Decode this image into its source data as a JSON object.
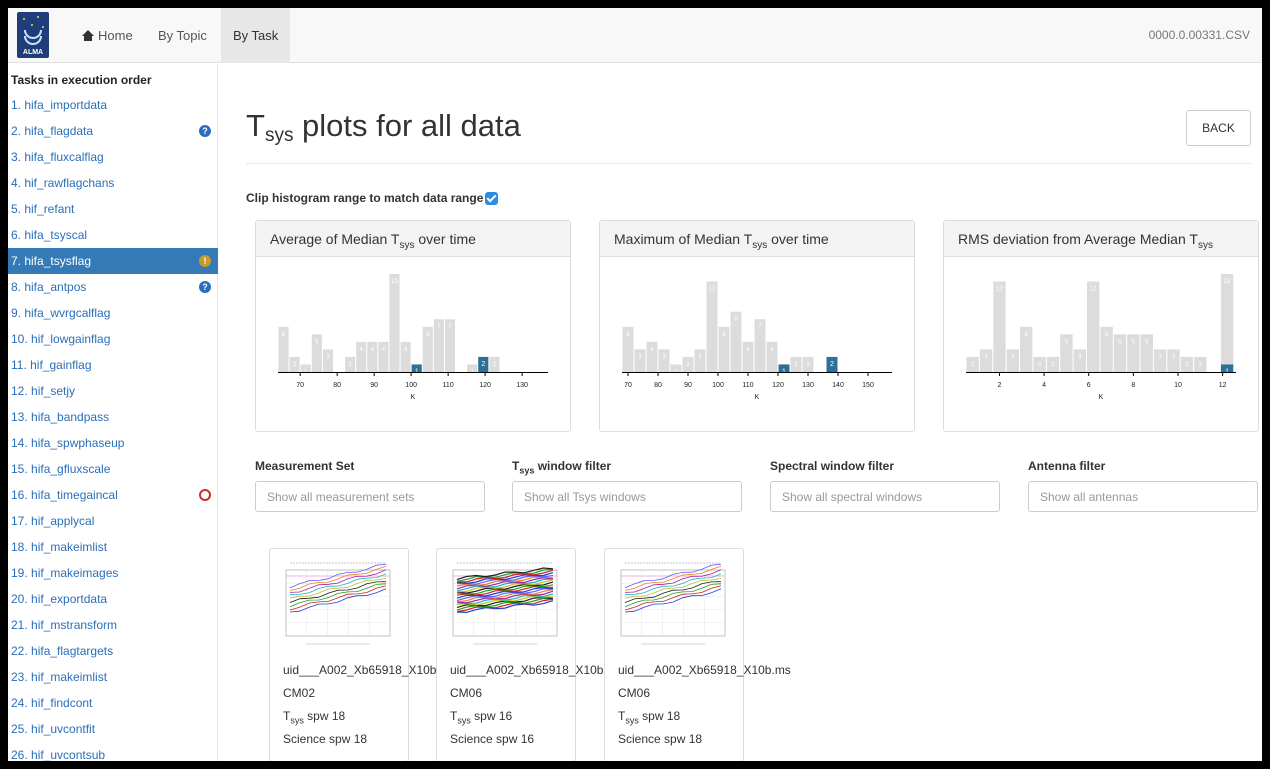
{
  "navbar": {
    "logo_text": "ALMA",
    "home_label": "Home",
    "by_topic_label": "By Topic",
    "by_task_label": "By Task",
    "filename": "0000.0.00331.CSV"
  },
  "sidebar": {
    "title": "Tasks in execution order",
    "items": [
      {
        "label": "1. hifa_importdata"
      },
      {
        "label": "2. hifa_flagdata",
        "badge": "info"
      },
      {
        "label": "3. hifa_fluxcalflag"
      },
      {
        "label": "4. hif_rawflagchans"
      },
      {
        "label": "5. hif_refant"
      },
      {
        "label": "6. hifa_tsyscal"
      },
      {
        "label": "7. hifa_tsysflag",
        "badge": "warning",
        "active": true
      },
      {
        "label": "8. hifa_antpos",
        "badge": "info"
      },
      {
        "label": "9. hifa_wvrgcalflag"
      },
      {
        "label": "10. hif_lowgainflag"
      },
      {
        "label": "11. hif_gainflag"
      },
      {
        "label": "12. hif_setjy"
      },
      {
        "label": "13. hifa_bandpass"
      },
      {
        "label": "14. hifa_spwphaseup"
      },
      {
        "label": "15. hifa_gfluxscale"
      },
      {
        "label": "16. hifa_timegaincal",
        "badge": "error"
      },
      {
        "label": "17. hif_applycal"
      },
      {
        "label": "18. hif_makeimlist"
      },
      {
        "label": "19. hif_makeimages"
      },
      {
        "label": "20. hif_exportdata"
      },
      {
        "label": "21. hif_mstransform"
      },
      {
        "label": "22. hifa_flagtargets"
      },
      {
        "label": "23. hif_makeimlist"
      },
      {
        "label": "24. hif_findcont"
      },
      {
        "label": "25. hif_uvcontfit"
      },
      {
        "label": "26. hif_uvcontsub"
      }
    ]
  },
  "main": {
    "title_prefix": "T",
    "title_sub": "sys",
    "title_rest": " plots for all data",
    "back_label": "BACK",
    "clip_label": "Clip histogram range to match data range",
    "clip_checked": true
  },
  "panels": [
    {
      "pre": "Average of Median T",
      "sub": "sys",
      "post": " over time"
    },
    {
      "pre": "Maximum of Median T",
      "sub": "sys",
      "post": " over time"
    },
    {
      "pre": "RMS deviation from Average Median T",
      "sub": "sys",
      "post": ""
    }
  ],
  "filters": [
    {
      "label_pre": "Measurement Set",
      "label_sub": "",
      "label_post": "",
      "placeholder": "Show all measurement sets"
    },
    {
      "label_pre": "T",
      "label_sub": "sys",
      "label_post": " window filter",
      "placeholder": "Show all Tsys windows"
    },
    {
      "label_pre": "Spectral window filter",
      "label_sub": "",
      "label_post": "",
      "placeholder": "Show all spectral windows"
    },
    {
      "label_pre": "Antenna filter",
      "label_sub": "",
      "label_post": "",
      "placeholder": "Show all antennas"
    }
  ],
  "thumbnails": [
    {
      "ms": "uid___A002_Xb65918_X10b",
      "antenna": "CM02",
      "tsys_pre": "T",
      "tsys_sub": "sys",
      "tsys_post": " spw 18",
      "science": "Science spw 18"
    },
    {
      "ms": "uid___A002_Xb65918_X10b",
      "antenna": "CM06",
      "tsys_pre": "T",
      "tsys_sub": "sys",
      "tsys_post": " spw 16",
      "science": "Science spw 16"
    },
    {
      "ms": "uid___A002_Xb65918_X10b.ms",
      "antenna": "CM06",
      "tsys_pre": "T",
      "tsys_sub": "sys",
      "tsys_post": " spw 18",
      "science": "Science spw 18"
    }
  ],
  "chart_data": [
    {
      "type": "bar",
      "title": "Average of Median Tsys over time",
      "xlabel": "K",
      "xlim": [
        64,
        137
      ],
      "xticks": [
        70,
        80,
        90,
        100,
        110,
        120,
        130
      ],
      "bin_width": 3,
      "values": [
        6,
        2,
        1,
        5,
        3,
        0,
        2,
        4,
        4,
        4,
        13,
        4,
        1,
        6,
        7,
        7,
        0,
        1,
        2,
        2
      ],
      "selected": [
        0,
        0,
        0,
        0,
        0,
        0,
        0,
        0,
        0,
        0,
        0,
        0,
        1,
        0,
        0,
        0,
        0,
        0,
        2,
        0
      ],
      "colors": {
        "all": "#dcdcdc",
        "selected": "#2e6f98"
      }
    },
    {
      "type": "bar",
      "title": "Maximum of Median Tsys over time",
      "xlabel": "K",
      "xlim": [
        68,
        158
      ],
      "xticks": [
        70,
        80,
        90,
        100,
        110,
        120,
        130,
        140,
        150
      ],
      "bin_width": 4,
      "values": [
        6,
        3,
        4,
        3,
        1,
        2,
        3,
        12,
        6,
        8,
        4,
        7,
        4,
        1,
        2,
        2,
        0,
        2
      ],
      "selected": [
        0,
        0,
        0,
        0,
        0,
        0,
        0,
        0,
        0,
        0,
        0,
        0,
        0,
        1,
        0,
        0,
        0,
        2
      ],
      "colors": {
        "all": "#dcdcdc",
        "selected": "#2e6f98"
      }
    },
    {
      "type": "bar",
      "title": "RMS deviation from Average Median Tsys",
      "xlabel": "K",
      "xlim": [
        0.5,
        12.6
      ],
      "xticks": [
        2,
        4,
        6,
        8,
        10,
        12
      ],
      "bin_width": 0.6,
      "values": [
        2,
        3,
        12,
        3,
        6,
        2,
        2,
        5,
        3,
        12,
        6,
        5,
        5,
        5,
        3,
        3,
        2,
        2,
        0,
        13
      ],
      "selected": [
        0,
        0,
        0,
        0,
        0,
        0,
        0,
        0,
        0,
        0,
        0,
        0,
        0,
        0,
        0,
        0,
        0,
        0,
        0,
        1
      ],
      "colors": {
        "all": "#dcdcdc",
        "selected": "#2e6f98"
      }
    }
  ]
}
